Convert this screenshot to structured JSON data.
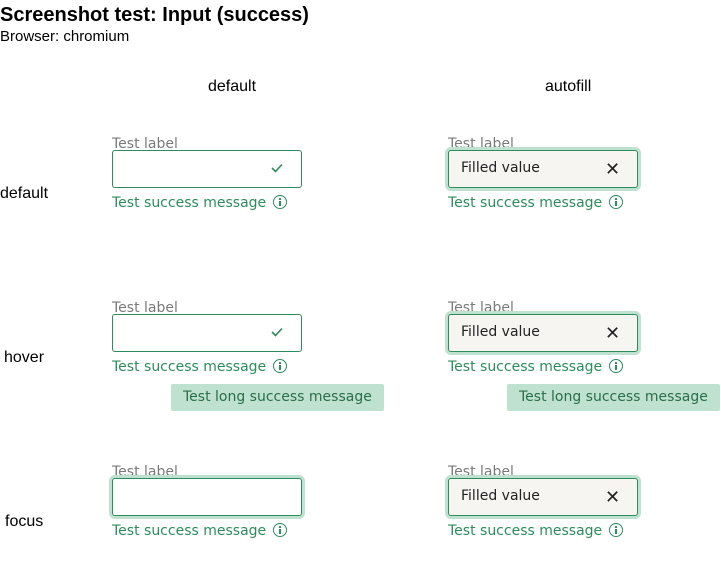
{
  "title": "Screenshot test: Input (success)",
  "browser": "Browser: chromium",
  "columns": {
    "default": "default",
    "autofill": "autofill"
  },
  "rows": {
    "default": "default",
    "hover": "hover",
    "focus": "focus"
  },
  "field": {
    "label": "Test label",
    "filled_value": "Filled value",
    "success_message": "Test success message",
    "tooltip": "Test long success message"
  },
  "colors": {
    "success": "#2e8b5b",
    "focus_ring": "#bfe1cf",
    "tooltip_bg": "#bfe1cf",
    "autofill_bg": "#f7f5f1"
  },
  "icons": {
    "valid": "check-icon",
    "clear": "close-icon",
    "info": "info-icon"
  }
}
